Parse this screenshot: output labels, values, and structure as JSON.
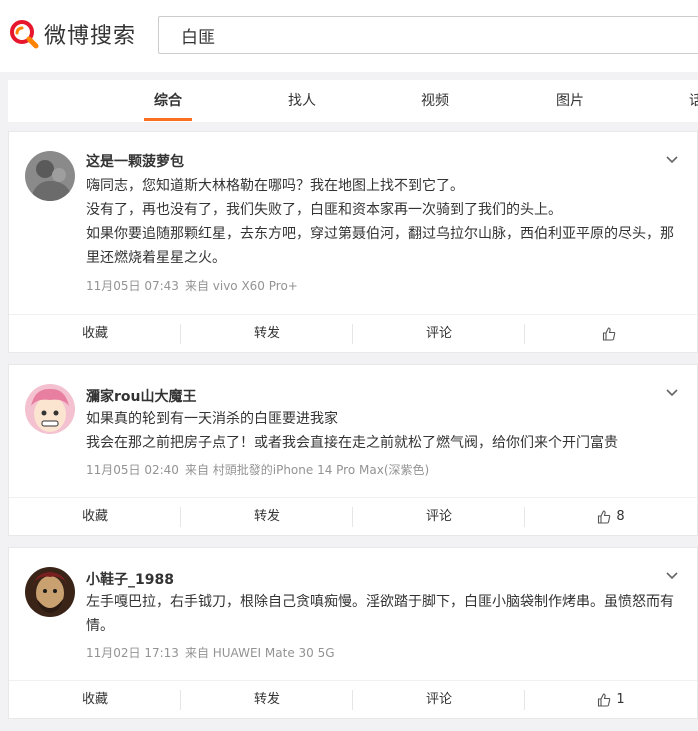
{
  "header": {
    "logo_text": "微博搜索",
    "search_value": "白匪"
  },
  "tabs": [
    {
      "label": "综合",
      "active": true
    },
    {
      "label": "找人"
    },
    {
      "label": "视频"
    },
    {
      "label": "图片"
    },
    {
      "label": "话"
    }
  ],
  "posts": [
    {
      "username": "这是一颗菠萝包",
      "paragraphs": [
        "嗨同志，您知道斯大林格勒在哪吗？我在地图上找不到它了。",
        "没有了，再也没有了，我们失败了，白匪和资本家再一次骑到了我们的头上。",
        "如果你要追随那颗红星，去东方吧，穿过第聂伯河，翻过乌拉尔山脉，西伯利亚平原的尽头，那里还燃烧着星星之火。"
      ],
      "time": "11月05日 07:43",
      "source": "来自 vivo X60 Pro+",
      "actions": {
        "favorite": "收藏",
        "repost": "转发",
        "comment": "评论",
        "like_count": ""
      }
    },
    {
      "username": "瀰家rou山大魔王",
      "paragraphs": [
        "如果真的轮到有一天消杀的白匪要进我家",
        "我会在那之前把房子点了！或者我会直接在走之前就松了燃气阀，给你们来个开门富贵"
      ],
      "time": "11月05日 02:40",
      "source": "来自 村頭批發的iPhone 14 Pro Max(深紫色)",
      "actions": {
        "favorite": "收藏",
        "repost": "转发",
        "comment": "评论",
        "like_count": "8"
      }
    },
    {
      "username": "小鞋子_1988",
      "paragraphs": [
        "左手嘎巴拉，右手钺刀，根除自己贪嗔痴慢。淫欲踏于脚下，白匪小脑袋制作烤串。虽愤怒而有情。"
      ],
      "time": "11月02日 17:13",
      "source": "来自 HUAWEI Mate 30 5G",
      "actions": {
        "favorite": "收藏",
        "repost": "转发",
        "comment": "评论",
        "like_count": "1"
      }
    }
  ],
  "colors": {
    "accent": "#fc6e21",
    "logo_red": "#e6162d",
    "logo_orange": "#ff8200"
  }
}
